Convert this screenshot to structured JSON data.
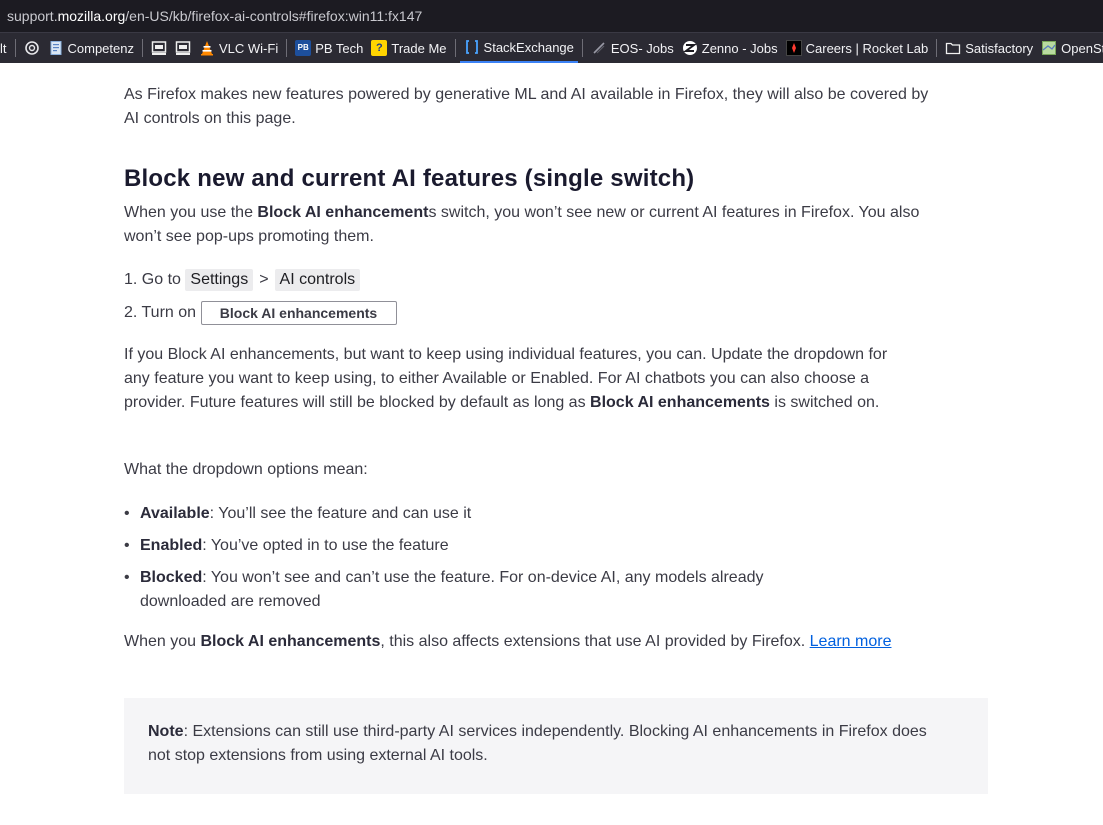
{
  "browser": {
    "url_prefix": "support.",
    "url_domain": "mozilla.org",
    "url_path": "/en-US/kb/firefox-ai-controls#firefox:win11:fx147"
  },
  "bookmarks": [
    {
      "icon": "",
      "label": "lt"
    },
    {
      "icon": "chatgpt-icon",
      "label": ""
    },
    {
      "icon": "document-icon",
      "label": "Competenz"
    },
    {
      "icon": "terminal-icon",
      "label": ""
    },
    {
      "icon": "terminal-icon",
      "label": ""
    },
    {
      "icon": "vlc-cone-icon",
      "label": "VLC Wi-Fi"
    },
    {
      "icon": "pbtech-icon",
      "label": "PB Tech"
    },
    {
      "icon": "trademe-icon",
      "label": "Trade Me"
    },
    {
      "icon": "stackexchange-icon",
      "label": "StackExchange"
    },
    {
      "icon": "eos-icon",
      "label": "EOS- Jobs"
    },
    {
      "icon": "zenno-icon",
      "label": "Zenno - Jobs"
    },
    {
      "icon": "rocketlab-icon",
      "label": "Careers | Rocket Lab"
    },
    {
      "icon": "folder-icon",
      "label": "Satisfactory"
    },
    {
      "icon": "openstreetmap-icon",
      "label": "OpenStreetMa"
    }
  ],
  "article": {
    "intro": "As Firefox makes new features powered by generative ML and AI available in Firefox, they will also be covered by AI controls on this page.",
    "heading": "Block new and current AI features (single switch)",
    "p1_a": "When you use the ",
    "p1_bold": "Block AI enhancement",
    "p1_b": "s switch, you won’t see new or current AI features in Firefox. You also won’t see pop-ups promoting them.",
    "step1_prefix": "Go to",
    "step1_settings": "Settings",
    "step1_sep": ">",
    "step1_ai_controls": "AI controls",
    "step2_prefix": "Turn on",
    "step2_toggle": "Block AI enhancements",
    "p2_a": "If you Block AI enhancements, but want to keep using individual features, you can. Update the dropdown for any feature you want to keep using, to either Available or Enabled. For AI chatbots you can also choose a provider. Future features will still be blocked by default as long as ",
    "p2_bold": "Block AI enhancements",
    "p2_b": " is switched on.",
    "p3": "What the dropdown options mean:",
    "options": [
      {
        "term": "Available",
        "desc": ": You’ll see the feature and can use it"
      },
      {
        "term": "Enabled",
        "desc": ": You’ve opted in to use the feature"
      },
      {
        "term": "Blocked",
        "desc": ": You won’t see and can’t use the feature. For on-device AI, any models already downloaded are removed"
      }
    ],
    "p4_a": "When you ",
    "p4_bold": "Block AI enhancements",
    "p4_b": ", this also affects extensions that use AI provided by Firefox. ",
    "p4_link": "Learn more",
    "note_label": "Note",
    "note_text": ": Extensions can still use third-party AI services independently. Blocking AI enhancements in Firefox does not stop extensions from using external AI tools."
  },
  "colors": {
    "link": "#0060df",
    "toolbar_bg": "#2b2a33",
    "urlbar_bg": "#1c1b22",
    "note_bg": "#f5f5f7"
  }
}
